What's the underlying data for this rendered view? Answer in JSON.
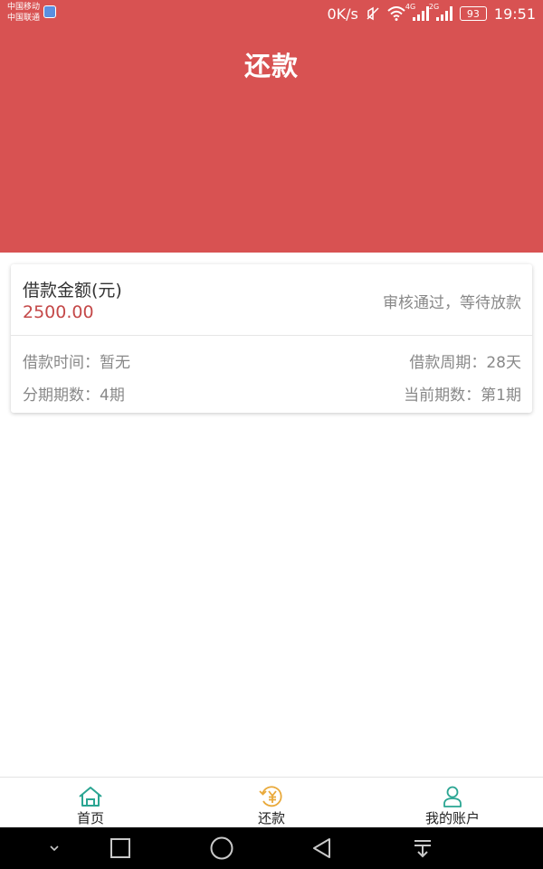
{
  "status_bar": {
    "carrier_1": "中国移动",
    "carrier_2": "中国联通",
    "speed": "0K/s",
    "signal_1_label": "4G",
    "signal_2_label": "2G",
    "battery": "93",
    "time": "19:51"
  },
  "header": {
    "title": "还款"
  },
  "loan": {
    "amount_label": "借款金额(元)",
    "amount_value": "2500.00",
    "status": "审核通过，等待放款",
    "loan_time": "借款时间：暂无",
    "loan_period": "借款周期：28天",
    "installments": "分期期数：4期",
    "current_period": "当前期数：第1期"
  },
  "tabbar": {
    "tabs": [
      {
        "label": "首页",
        "icon": "home-icon"
      },
      {
        "label": "还款",
        "icon": "repay-yen-icon"
      },
      {
        "label": "我的账户",
        "icon": "user-icon"
      }
    ]
  },
  "colors": {
    "brand_red": "#d85252",
    "amount_red": "#c44848",
    "home_icon": "#2aa592",
    "repay_icon": "#e9a93a",
    "account_icon": "#2aa592"
  }
}
